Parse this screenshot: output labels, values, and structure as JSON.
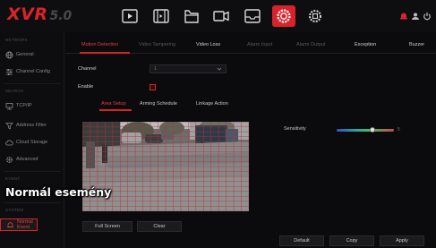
{
  "app": {
    "brand": "XVR",
    "version": "5.0"
  },
  "toolbar": {
    "icons": [
      "playback-icon",
      "video-file-icon",
      "folder-icon",
      "record-icon",
      "storage-icon",
      "event-gear-icon",
      "system-settings-icon"
    ],
    "active_icon": "event-gear-icon"
  },
  "sidebar": {
    "sections": {
      "network": "NETWORK",
      "search": "SEARCH",
      "event": "EVENT",
      "system": "SYSTEM"
    },
    "items": [
      {
        "label": "General",
        "icon": "globe-icon"
      },
      {
        "label": "Channel Config",
        "icon": "sliders-icon"
      },
      {
        "label": "TCP/IP",
        "icon": "network-icon"
      },
      {
        "label": "Address Filter",
        "icon": "filter-icon"
      },
      {
        "label": "Cloud Storage",
        "icon": "cloud-icon"
      },
      {
        "label": "Advanced",
        "icon": "gear-icon"
      },
      {
        "label": "Normal Event",
        "icon": "bell-icon"
      }
    ],
    "active_item": "Normal Event"
  },
  "tabs": [
    {
      "label": "Motion Detection",
      "state": "active"
    },
    {
      "label": "Video Tampering",
      "state": "dim"
    },
    {
      "label": "Video Loss",
      "state": "bright"
    },
    {
      "label": "Alarm Input",
      "state": "dim"
    },
    {
      "label": "Alarm Output",
      "state": "dim"
    },
    {
      "label": "Exception",
      "state": "bright"
    },
    {
      "label": "Buzzer",
      "state": "bright"
    }
  ],
  "form": {
    "channel_label": "Channel",
    "channel_value": "1",
    "enable_label": "Enable",
    "enable_checked": true
  },
  "subtabs": [
    {
      "label": "Area Setup",
      "state": "active"
    },
    {
      "label": "Arming Schedule",
      "state": "normal"
    },
    {
      "label": "Linkage Action",
      "state": "normal"
    }
  ],
  "sensitivity": {
    "label": "Sensitivity",
    "value": 5,
    "max": 8,
    "value_text": "5"
  },
  "buttons": {
    "full_screen": "Full Screen",
    "clear": "Clear",
    "default": "Default",
    "copy": "Copy",
    "apply": "Apply"
  },
  "overlay_caption": "Normál esemény",
  "colors": {
    "accent": "#d8232a",
    "background": "#0b0b0d",
    "panel": "#1b1b1e",
    "grid": "#c03030"
  }
}
